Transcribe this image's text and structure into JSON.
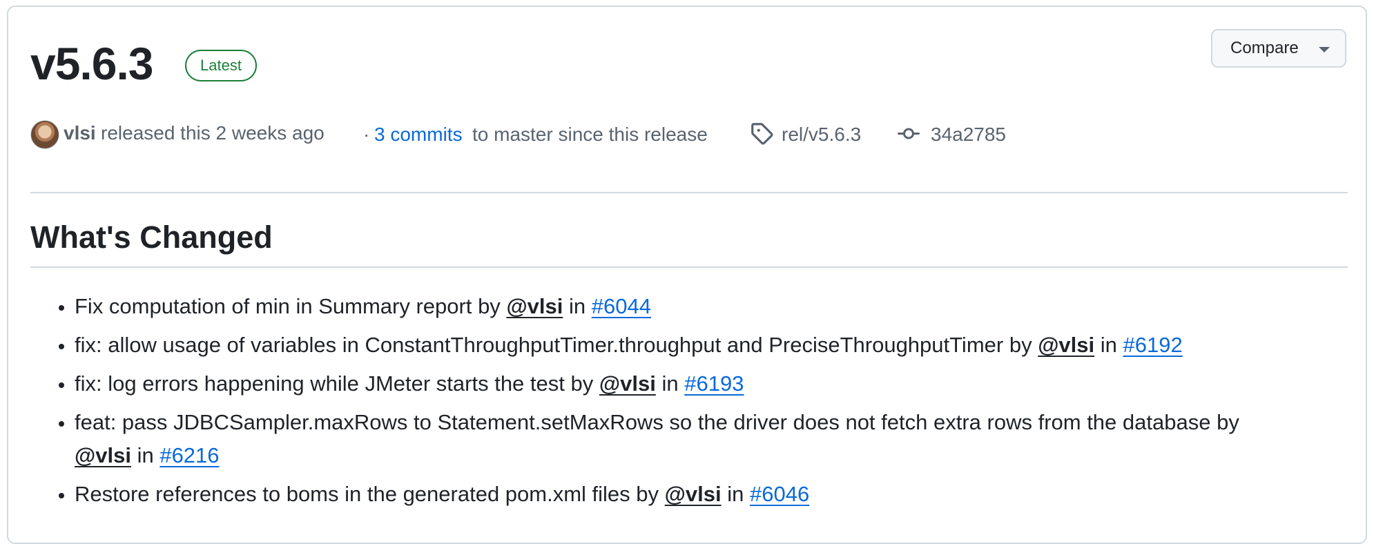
{
  "release": {
    "version": "v5.6.3",
    "badge": "Latest",
    "compare_label": "Compare"
  },
  "meta": {
    "author": "vlsi",
    "released_text": "released this 2 weeks ago",
    "dot": "·",
    "commits_link": "3 commits",
    "commits_rest": "to master since this release",
    "tag": "rel/v5.6.3",
    "commit_sha": "34a2785",
    "icons": [
      "avatar",
      "tag-icon",
      "git-commit-icon"
    ]
  },
  "notes": {
    "heading": "What's Changed",
    "by": "by",
    "in": "in",
    "items": [
      {
        "text": "Fix computation of min in Summary report",
        "user": "@vlsi",
        "pr": "#6044"
      },
      {
        "text": "fix: allow usage of variables in ConstantThroughputTimer.throughput and PreciseThroughputTimer",
        "user": "@vlsi",
        "pr": "#6192"
      },
      {
        "text": "fix: log errors happening while JMeter starts the test",
        "user": "@vlsi",
        "pr": "#6193"
      },
      {
        "text": "feat: pass JDBCSampler.maxRows to Statement.setMaxRows so the driver does not fetch extra rows from the database",
        "user": "@vlsi",
        "pr": "#6216"
      },
      {
        "text": "Restore references to boms in the generated pom.xml files",
        "user": "@vlsi",
        "pr": "#6046"
      }
    ]
  },
  "colors": {
    "link": "#0969da",
    "latest_badge": "#1a7f37",
    "muted": "#59636e",
    "border": "#d1d9e0"
  }
}
